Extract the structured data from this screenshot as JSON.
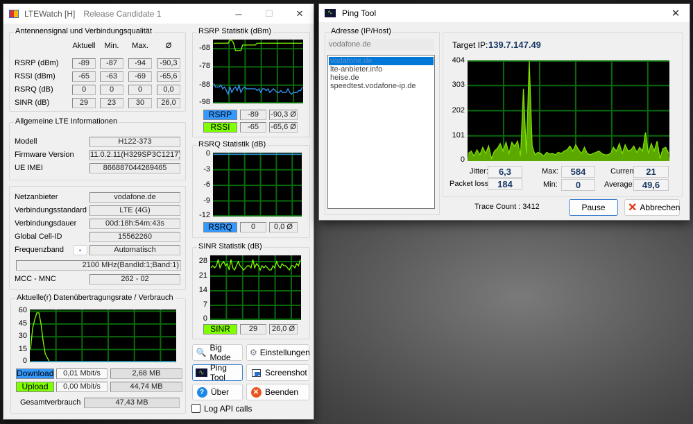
{
  "main_window": {
    "title": "LTEWatch [H]",
    "subtitle": "Release Candidate 1",
    "signal_group": {
      "title": "Antennensignal und Verbindungsqualität",
      "columns": [
        "Aktuell",
        "Min.",
        "Max.",
        "Ø"
      ],
      "rows": [
        {
          "label": "RSRP (dBm)",
          "values": [
            "-89",
            "-87",
            "-94",
            "-90,3"
          ]
        },
        {
          "label": "RSSI (dBm)",
          "values": [
            "-65",
            "-63",
            "-69",
            "-65,6"
          ]
        },
        {
          "label": "RSRQ (dB)",
          "values": [
            "0",
            "0",
            "0",
            "0,0"
          ]
        },
        {
          "label": "SINR (dB)",
          "values": [
            "29",
            "23",
            "30",
            "26,0"
          ]
        }
      ]
    },
    "lte_group": {
      "title": "Allgemeine LTE Informationen",
      "device": [
        {
          "label": "Modell",
          "value": "H122-373"
        },
        {
          "label": "Firmware Version",
          "value": "11.0.2.11(H329SP3C1217)"
        },
        {
          "label": "UE IMEI",
          "value": "866887044269465"
        }
      ],
      "network": [
        {
          "label": "Netzanbieter",
          "value": "vodafone.de"
        },
        {
          "label": "Verbindungsstandard",
          "value": "LTE (4G)"
        },
        {
          "label": "Verbindungsdauer",
          "value": "00d:18h:54m:43s"
        },
        {
          "label": "Global Cell-ID",
          "value": "15562260"
        },
        {
          "label": "Frequenzband",
          "value": "Automatisch"
        }
      ],
      "band_button": "•",
      "band_info": "2100 MHz(BandId:1;Band:1)",
      "mcc_label": "MCC - MNC",
      "mcc_value": "262 - 02"
    },
    "traffic_group": {
      "title": "Aktuelle(r) Datenübertragungsrate / Verbrauch",
      "download_label": "Download",
      "download_rate": "0,01 Mbit/s",
      "download_total": "2,68 MB",
      "upload_label": "Upload",
      "upload_rate": "0,00 Mbit/s",
      "upload_total": "44,74 MB",
      "total_label": "Gesamtverbrauch",
      "total_value": "47,43 MB"
    },
    "rsrp_group": {
      "title": "RSRP Statistik (dBm)",
      "rsrp_label": "RSRP",
      "rsrp_value": "-89",
      "rsrp_avg": "-90,3 Ø",
      "rssi_label": "RSSI",
      "rssi_value": "-65",
      "rssi_avg": "-65,6 Ø"
    },
    "rsrq_group": {
      "title": "RSRQ Statistik (dB)",
      "label": "RSRQ",
      "value": "0",
      "avg": "0,0 Ø"
    },
    "sinr_group": {
      "title": "SINR Statistik (dB)",
      "label": "SINR",
      "value": "29",
      "avg": "26,0 Ø"
    },
    "buttons": {
      "big_mode": "Big Mode",
      "settings": "Einstellungen",
      "ping_tool": "Ping Tool",
      "screenshot": "Screenshot",
      "about": "Über",
      "quit": "Beenden"
    },
    "log_api_label": "Log API calls"
  },
  "ping_window": {
    "title": "Ping Tool",
    "address_group_title": "Adresse (IP/Host)",
    "address_input": "vodafone.de",
    "hosts": [
      "vodafone.de",
      "lte-anbieter.info",
      "heise.de",
      "speedtest.vodafone-ip.de"
    ],
    "target_ip_label": "Target IP:",
    "target_ip": "139.7.147.49",
    "stats": {
      "jitter_label": "Jitter:",
      "jitter": "6,3",
      "max_label": "Max:",
      "max": "584",
      "current_label": "Current:",
      "current": "21",
      "loss_label": "Packet loss:",
      "loss": "184",
      "min_label": "Min:",
      "min": "0",
      "average_label": "Average:",
      "average": "49,6"
    },
    "trace_count": "Trace Count : 3412",
    "pause_label": "Pause",
    "cancel_label": "Abbrechen"
  },
  "colors": {
    "rsrp": "#3399ff",
    "rssi": "#80ff00",
    "grid": "#0a6a0a",
    "ping_fill": "#5aa800"
  },
  "chart_data": [
    {
      "id": "rsrp",
      "type": "line",
      "title": "RSRP Statistik (dBm)",
      "ylim": [
        -98,
        -63
      ],
      "yticks": [
        "-68",
        "-78",
        "-88",
        "-98"
      ],
      "series": [
        {
          "name": "RSSI",
          "color": "#80ff00",
          "values": [
            -65,
            -65,
            -65,
            -65,
            -65,
            -65,
            -65,
            -65,
            -65,
            -63,
            -63,
            -65,
            -69,
            -69,
            -69,
            -69,
            -66,
            -66,
            -66,
            -66,
            -66,
            -66,
            -66,
            -66,
            -65,
            -65,
            -65,
            -65,
            -65,
            -65,
            -65,
            -65,
            -65,
            -65,
            -65,
            -65,
            -65,
            -65,
            -65,
            -65,
            -65,
            -65,
            -65,
            -65,
            -65,
            -65,
            -65,
            -65,
            -65,
            -65
          ]
        },
        {
          "name": "RSRP",
          "color": "#3399ff",
          "values": [
            -87,
            -89,
            -89,
            -89,
            -88,
            -90,
            -89,
            -91,
            -93,
            -89,
            -92,
            -90,
            -89,
            -91,
            -88,
            -92,
            -90,
            -89,
            -90,
            -90,
            -90,
            -90,
            -90,
            -90,
            -91,
            -90,
            -92,
            -90,
            -90,
            -91,
            -90,
            -92,
            -91,
            -90,
            -91,
            -92,
            -92,
            -91,
            -92,
            -92,
            -92,
            -90,
            -92,
            -93,
            -92,
            -92,
            -92,
            -91,
            -91,
            -89
          ]
        }
      ]
    },
    {
      "id": "rsrq",
      "type": "line",
      "title": "RSRQ Statistik (dB)",
      "ylim": [
        -12,
        0.3
      ],
      "yticks": [
        "0",
        "-3",
        "-6",
        "-9",
        "-12"
      ],
      "series": [
        {
          "name": "RSRQ",
          "color": "#3399ff",
          "values": [
            0,
            0,
            0,
            0,
            0,
            0,
            0,
            0,
            0,
            0
          ]
        }
      ]
    },
    {
      "id": "sinr",
      "type": "line",
      "title": "SINR Statistik (dB)",
      "ylim": [
        0,
        31
      ],
      "yticks": [
        "28",
        "21",
        "14",
        "7",
        "0"
      ],
      "series": [
        {
          "name": "SINR",
          "color": "#80ff00",
          "values": [
            25,
            26,
            25,
            26,
            29,
            25,
            27,
            28,
            26,
            27,
            24,
            29,
            25,
            24,
            26,
            28,
            26,
            25,
            24,
            25,
            26,
            26,
            25,
            29,
            25,
            27,
            26,
            24,
            26,
            25,
            26,
            25,
            24,
            24,
            26,
            25,
            28,
            26,
            25,
            27,
            26,
            26,
            25,
            24,
            26,
            26,
            25,
            27,
            26,
            29
          ]
        }
      ]
    },
    {
      "id": "traffic",
      "type": "line",
      "title": "Aktuelle(r) Datenübertragungsrate / Verbrauch",
      "ylim": [
        0,
        62
      ],
      "yticks": [
        "60",
        "45",
        "30",
        "15",
        "0"
      ],
      "series": [
        {
          "name": "Upload",
          "color": "#80ff00",
          "values": [
            15,
            40,
            50,
            58,
            58,
            45,
            25,
            10,
            5,
            0,
            0,
            0,
            0,
            0,
            0,
            0,
            0,
            0,
            0,
            0,
            0,
            0,
            0,
            0,
            0,
            0,
            0,
            0,
            0,
            0,
            0,
            0,
            0,
            0,
            0,
            0,
            0,
            0,
            0,
            0,
            0,
            0,
            0,
            0,
            0,
            0,
            0,
            0,
            0,
            0,
            0,
            0,
            0,
            0,
            0,
            0,
            0,
            0,
            0,
            0,
            0,
            0,
            0,
            0,
            0,
            0,
            0,
            0,
            0,
            0
          ]
        },
        {
          "name": "Download",
          "color": "#3399ff",
          "values": [
            0,
            0,
            0,
            0,
            0,
            0,
            0,
            0,
            0,
            0,
            0,
            0,
            0,
            0,
            0,
            0,
            0,
            0,
            0,
            0,
            0,
            0,
            0,
            0,
            0,
            0,
            0,
            0,
            0,
            0,
            0,
            0,
            0,
            0,
            0,
            0,
            0,
            0,
            0,
            0,
            0,
            0,
            0,
            0,
            0,
            0,
            0,
            0,
            0,
            0,
            0,
            0,
            0,
            0,
            0,
            0,
            0,
            0,
            0,
            0,
            0,
            0,
            0,
            0,
            0,
            0,
            0,
            0,
            0,
            0
          ]
        }
      ]
    },
    {
      "id": "ping",
      "type": "area",
      "title": "Ping",
      "ylim": [
        0,
        404
      ],
      "yticks": [
        "404",
        "303",
        "202",
        "101",
        "0"
      ],
      "series": [
        {
          "name": "Ping",
          "color": "#80e000",
          "values": [
            30,
            40,
            20,
            45,
            25,
            55,
            30,
            60,
            10,
            40,
            50,
            70,
            40,
            75,
            30,
            75,
            60,
            80,
            20,
            290,
            30,
            404,
            60,
            25,
            35,
            30,
            20,
            35,
            28,
            30,
            25,
            35,
            30,
            40,
            45,
            60,
            40,
            65,
            45,
            30,
            55,
            30,
            25,
            30,
            35,
            40,
            30,
            25,
            25,
            30,
            55,
            40,
            70,
            30,
            65,
            40,
            45,
            60,
            35,
            55,
            40,
            115,
            30,
            70,
            40,
            80,
            10,
            50,
            55,
            30
          ]
        }
      ]
    }
  ]
}
